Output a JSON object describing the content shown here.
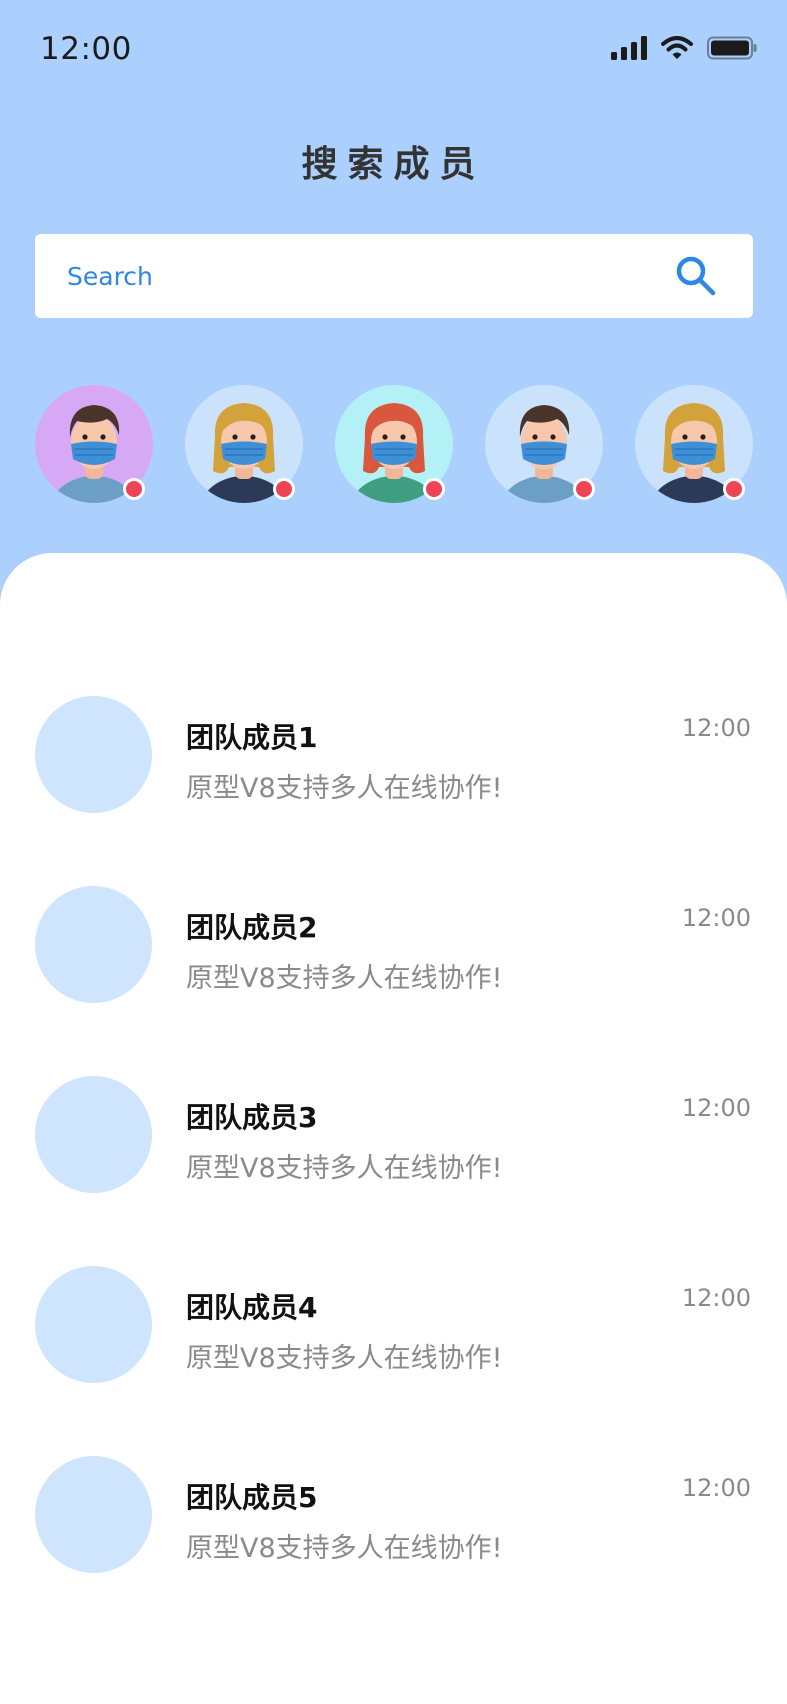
{
  "status_bar": {
    "time": "12:00",
    "icons": [
      "cellular-signal-icon",
      "wifi-icon",
      "battery-icon"
    ]
  },
  "header": {
    "title": "搜索成员"
  },
  "search": {
    "placeholder": "Search",
    "icon": "search-icon"
  },
  "online_members": [
    {
      "name": "online-member-1",
      "background": "#d6a8f5",
      "hair": "#4a3328",
      "shirt": "#6c9fc4",
      "online": true
    },
    {
      "name": "online-member-2",
      "background": "#cbe2fc",
      "hair": "#d4a23a",
      "shirt": "#2d3a57",
      "online": true
    },
    {
      "name": "online-member-3",
      "background": "#b4f1f6",
      "hair": "#d8573d",
      "shirt": "#3f9f80",
      "online": true
    },
    {
      "name": "online-member-4",
      "background": "#cbe2fc",
      "hair": "#4a3328",
      "shirt": "#6c9fc4",
      "online": true
    },
    {
      "name": "online-member-5",
      "background": "#cbe2fc",
      "hair": "#d4a23a",
      "shirt": "#2d3a57",
      "online": true
    }
  ],
  "members": [
    {
      "name": "团队成员1",
      "message": "原型V8支持多人在线协作!",
      "time": "12:00"
    },
    {
      "name": "团队成员2",
      "message": "原型V8支持多人在线协作!",
      "time": "12:00"
    },
    {
      "name": "团队成员3",
      "message": "原型V8支持多人在线协作!",
      "time": "12:00"
    },
    {
      "name": "团队成员4",
      "message": "原型V8支持多人在线协作!",
      "time": "12:00"
    },
    {
      "name": "团队成员5",
      "message": "原型V8支持多人在线协作!",
      "time": "12:00"
    }
  ],
  "colors": {
    "header_background": "#abd0fd",
    "accent": "#2e86e6",
    "online_dot": "#ef4455",
    "placeholder_avatar": "#cfe4fd"
  }
}
